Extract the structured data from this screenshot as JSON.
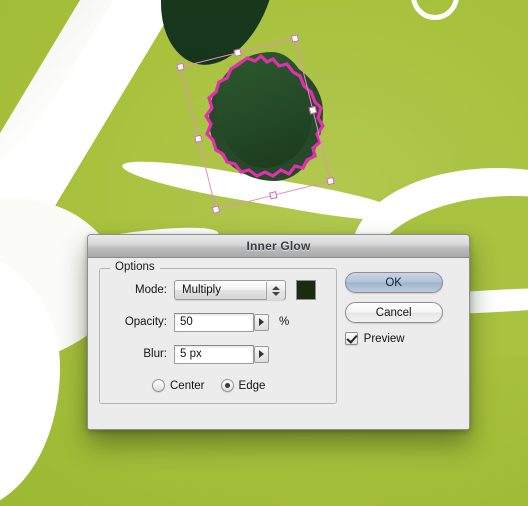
{
  "canvas": {
    "background_color": "#a9c23f",
    "artwork_description": "calligraphic white brush strokes on olive-green background",
    "stroke_color": "#ffffff",
    "leaf_color": "#27492a",
    "selection_color": "#e22fb0",
    "transform_box_color": "#e88ec0"
  },
  "dialog": {
    "title": "Inner Glow",
    "options_group_label": "Options",
    "fields": {
      "mode": {
        "label": "Mode:",
        "value": "Multiply",
        "swatch_color": "#1a2c0e"
      },
      "opacity": {
        "label": "Opacity:",
        "value": "50",
        "unit": "%"
      },
      "blur": {
        "label": "Blur:",
        "value": "5 px"
      }
    },
    "source": {
      "center_label": "Center",
      "edge_label": "Edge",
      "selected": "Edge"
    },
    "buttons": {
      "ok": "OK",
      "cancel": "Cancel"
    },
    "preview": {
      "label": "Preview",
      "checked": true
    }
  }
}
